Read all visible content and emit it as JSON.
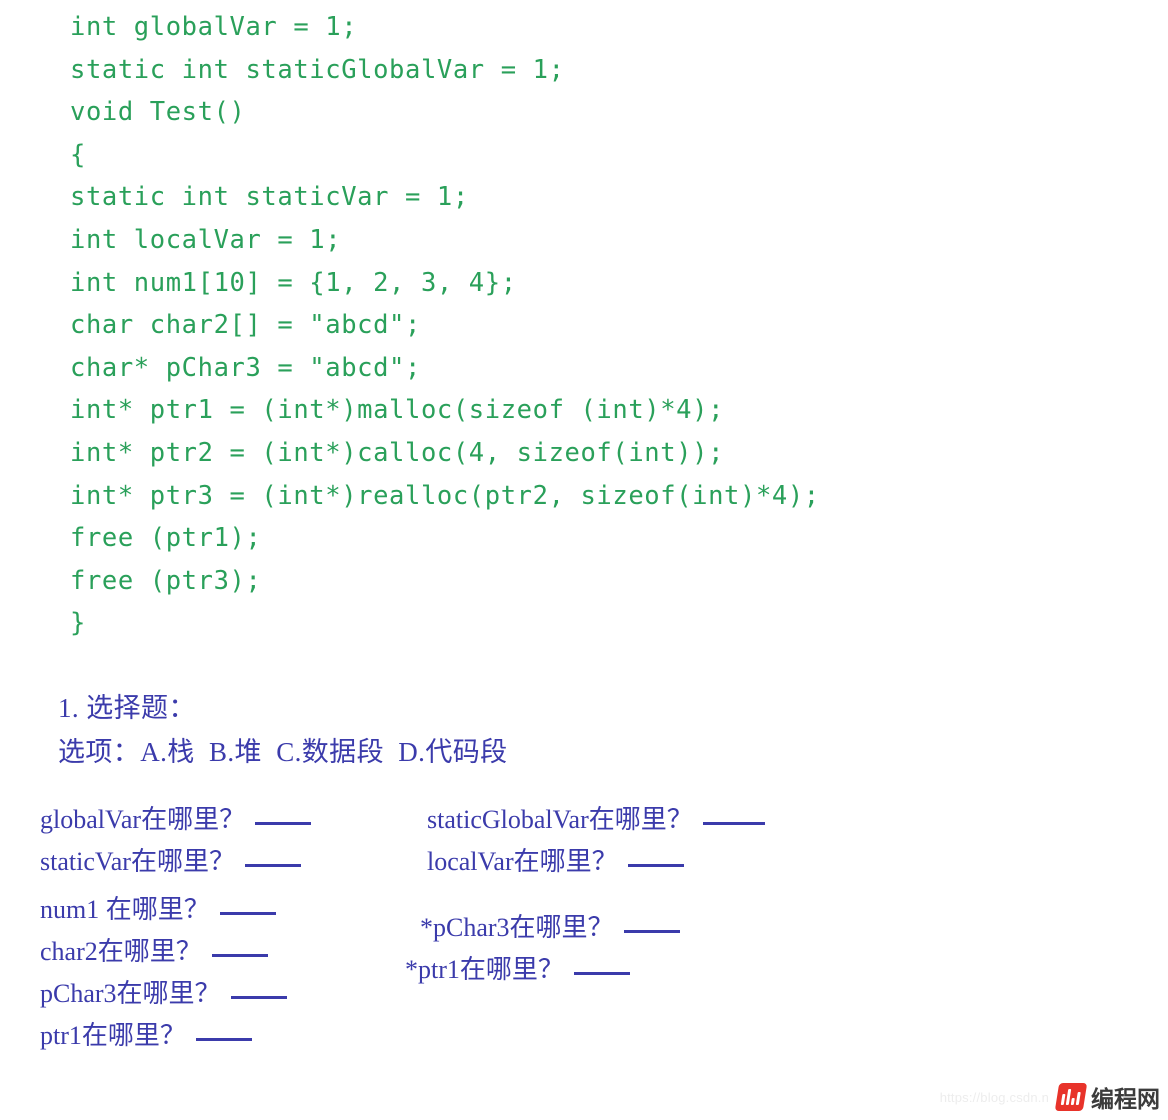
{
  "colors": {
    "code_green": "#2aa05a",
    "quiz_blue": "#3b3bab",
    "logo_red": "#e8332a",
    "watermark_gray": "#ededed",
    "background": "#ffffff"
  },
  "code": {
    "language": "c",
    "lines": [
      "int globalVar = 1;",
      "static int staticGlobalVar = 1;",
      "void Test()",
      "{",
      "static int staticVar = 1;",
      "int localVar = 1;",
      "int num1[10] = {1, 2, 3, 4};",
      "char char2[] = \"abcd\";",
      "char* pChar3 = \"abcd\";",
      "int* ptr1 = (int*)malloc(sizeof (int)*4);",
      "int* ptr2 = (int*)calloc(4, sizeof(int));",
      "int* ptr3 = (int*)realloc(ptr2, sizeof(int)*4);",
      "free (ptr1);",
      "free (ptr3);",
      "}"
    ]
  },
  "quiz": {
    "title": "1. 选择题：",
    "options_line": "选项：A.栈  B.堆  C.数据段  D.代码段",
    "options": [
      {
        "key": "A",
        "label": "栈"
      },
      {
        "key": "B",
        "label": "堆"
      },
      {
        "key": "C",
        "label": "数据段"
      },
      {
        "key": "D",
        "label": "代码段"
      }
    ],
    "blank_placeholder": "____",
    "questions": {
      "left": [
        {
          "id": "globalVar",
          "text": "globalVar在哪里？"
        },
        {
          "id": "staticVar",
          "text": "staticVar在哪里？"
        },
        {
          "id": "num1",
          "text": "num1 在哪里？"
        },
        {
          "id": "char2",
          "text": "char2在哪里？"
        },
        {
          "id": "pChar3",
          "text": "pChar3在哪里？"
        },
        {
          "id": "ptr1",
          "text": "ptr1在哪里？"
        }
      ],
      "right": [
        {
          "id": "staticGlobalVar",
          "text": "staticGlobalVar在哪里？"
        },
        {
          "id": "localVar",
          "text": "localVar在哪里？"
        },
        {
          "id": "deref_pChar3",
          "text": "*pChar3在哪里？"
        },
        {
          "id": "deref_ptr1",
          "text": "*ptr1在哪里？"
        }
      ]
    }
  },
  "watermark": {
    "url": "https://blog.csdn.n",
    "site_name": "编程网",
    "logo_icon": "bar-chart-logo-icon"
  }
}
